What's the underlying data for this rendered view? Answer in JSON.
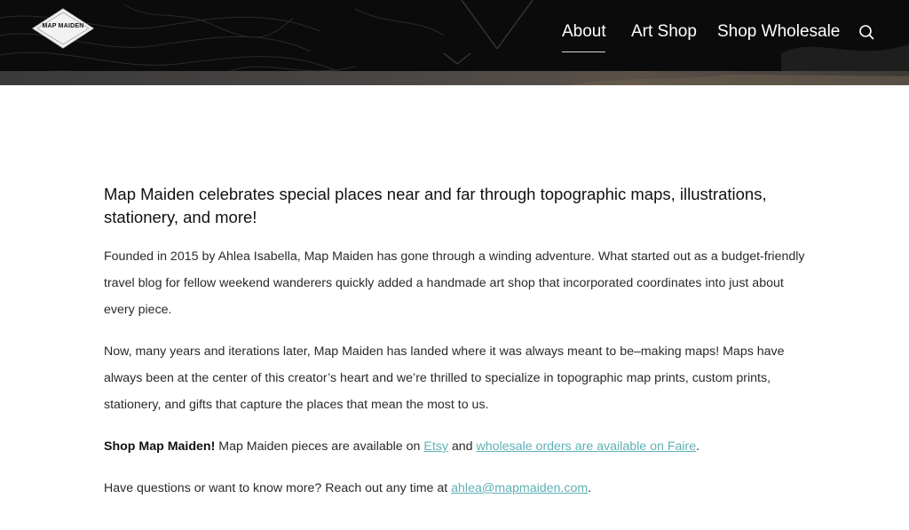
{
  "header": {
    "logo_text": "MAP MAIDEN",
    "nav": {
      "about": "About",
      "art_shop": "Art Shop",
      "shop_wholesale": "Shop Wholesale"
    },
    "search_icon": "search-icon"
  },
  "main": {
    "lead": "Map Maiden celebrates special places near and far through topographic maps, illustrations, stationery, and more!",
    "p1": "Founded in 2015 by Ahlea Isabella, Map Maiden has gone through a winding adventure. What started out as a budget-friendly travel blog for fellow weekend wanderers quickly added a handmade art shop that incorporated coordinates into just about every piece.",
    "p2": "Now, many years and iterations later, Map Maiden has landed where it was always meant to be–making maps! Maps have always been at the center of this creator’s heart and we’re thrilled to specialize in topographic map prints, custom prints, stationery, and gifts that capture the places that mean the most to us.",
    "p3": {
      "strong": "Shop Map Maiden!",
      "text1": " Map Maiden pieces are available on ",
      "link_etsy": "Etsy",
      "text2": " and ",
      "link_faire": "wholesale orders are available on Faire",
      "text3": "."
    },
    "p4": {
      "text1": "Have questions or want to know more? Reach out any time at ",
      "link_email": "ahlea@mapmaiden.com",
      "text2": "."
    }
  },
  "colors": {
    "link": "#5fb0b6",
    "header_bg": "#0d0d0d"
  }
}
